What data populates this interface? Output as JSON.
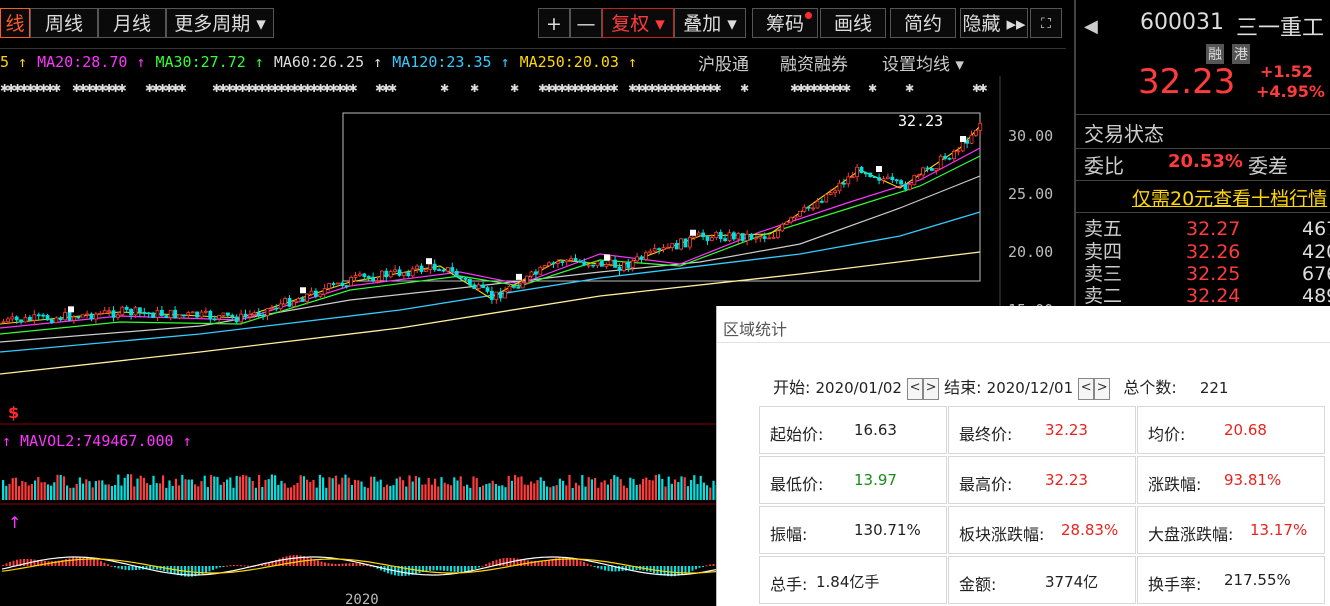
{
  "toolbar": {
    "tabs": [
      "线",
      "周线",
      "月线",
      "更多周期 ▾"
    ],
    "tools": [
      "+",
      "—",
      "复权 ▾",
      "叠加 ▾",
      "筹码",
      "画线",
      "简约",
      "隐藏 ▸▸"
    ],
    "menu": [
      "沪股通",
      "融资融券",
      "设置均线 ▾"
    ]
  },
  "ma_row": [
    {
      "text": "5 ↑",
      "color": "#ffd700"
    },
    {
      "text": "MA20:28.70 ↑",
      "color": "#ff33ff"
    },
    {
      "text": "MA30:27.72 ↑",
      "color": "#33ff33"
    },
    {
      "text": "MA60:26.25 ↑",
      "color": "#dddddd"
    },
    {
      "text": "MA120:23.35 ↑",
      "color": "#33ccff"
    },
    {
      "text": "MA250:20.03 ↑",
      "color": "#ffd700"
    }
  ],
  "chart": {
    "y_ticks": [
      "30.00",
      "25.00",
      "20.00",
      "15.00"
    ],
    "last_price_label": "32.23",
    "vol_label": "↑  MAVOL2:749467.000 ↑",
    "macd_arrow": "↑",
    "s_marker": "$",
    "x_year": "2020"
  },
  "right_panel": {
    "code": "600031",
    "name": "三一重工",
    "tags": [
      "融",
      "港"
    ],
    "price": "32.23",
    "change": "+1.52",
    "change_pct": "+4.95%",
    "status_label": "交易状态",
    "ratio_label": "委比",
    "ratio_value": "20.53%",
    "diff_label": "委差",
    "promo": "仅需20元查看十档行情",
    "asks": [
      {
        "label": "卖五",
        "price": "32.27",
        "vol": "467"
      },
      {
        "label": "卖四",
        "price": "32.26",
        "vol": "420"
      },
      {
        "label": "卖三",
        "price": "32.25",
        "vol": "676"
      },
      {
        "label": "卖二",
        "price": "32.24",
        "vol": "489"
      }
    ]
  },
  "popup": {
    "title": "区域统计",
    "start_label": "开始:",
    "start_value": "2020/01/02",
    "end_label": "结束:",
    "end_value": "2020/12/01",
    "count_label": "总个数:",
    "count_value": "221",
    "stats": [
      {
        "label": "起始价:",
        "value": "16.63",
        "tone": "dark"
      },
      {
        "label": "最终价:",
        "value": "32.23",
        "tone": "red"
      },
      {
        "label": "均价:",
        "value": "20.68",
        "tone": "red"
      },
      {
        "label": "最低价:",
        "value": "13.97",
        "tone": "green"
      },
      {
        "label": "最高价:",
        "value": "32.23",
        "tone": "red"
      },
      {
        "label": "涨跌幅:",
        "value": "93.81%",
        "tone": "red"
      },
      {
        "label": "振幅:",
        "value": "130.71%",
        "tone": "dark"
      },
      {
        "label": "板块涨跌幅:",
        "value": "28.83%",
        "tone": "red"
      },
      {
        "label": "大盘涨跌幅:",
        "value": "13.17%",
        "tone": "red"
      },
      {
        "label": "总手:",
        "value": "1.84亿手",
        "tone": "dark"
      },
      {
        "label": "金额:",
        "value": "3774亿",
        "tone": "dark"
      },
      {
        "label": "换手率:",
        "value": "217.55%",
        "tone": "dark"
      }
    ]
  }
}
